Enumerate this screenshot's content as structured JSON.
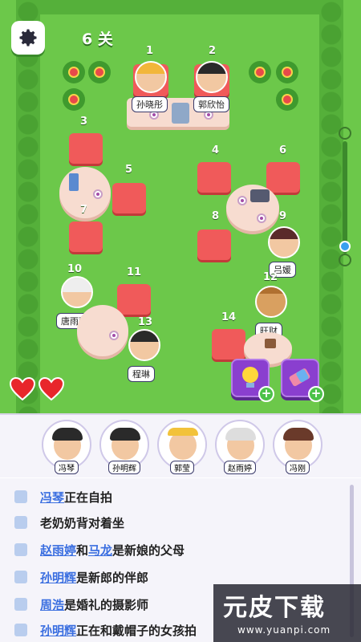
{
  "header": {
    "level": "6 关"
  },
  "colors": {
    "grass": "#6cc84a",
    "chair": "#f05a5a",
    "tool": "#8a3fcf",
    "heart": "#e8262b",
    "highlight": "#3a6ee0"
  },
  "seats": {
    "n1": "1",
    "n2": "2",
    "n3": "3",
    "n4": "4",
    "n5": "5",
    "n6": "6",
    "n7": "7",
    "n8": "8",
    "n9": "9",
    "n10": "10",
    "n11": "11",
    "n12": "12",
    "n13": "13",
    "n14": "14"
  },
  "seated": {
    "s1": "孙晓彤",
    "s2": "郭欣怡",
    "s9": "吕媛",
    "s10": "唐雨萱",
    "s12": "旺财",
    "s13": "程琳"
  },
  "hearts": {
    "count": 2
  },
  "tools": [
    {
      "icon": "lightbulb-icon"
    },
    {
      "icon": "eraser-icon"
    }
  ],
  "guests": [
    "冯琴",
    "孙明辉",
    "郭莹",
    "赵雨婷",
    "冯刚"
  ],
  "clues": [
    {
      "hl": "冯琴",
      "text": "正在自拍"
    },
    {
      "hl": "",
      "text": "老奶奶背对着坐"
    },
    {
      "hl": "赵雨婷",
      "mid": "和",
      "hl2": "马龙",
      "text": "是新娘的父母"
    },
    {
      "hl": "孙明辉",
      "text": "是新郎的伴郎"
    },
    {
      "hl": "周浩",
      "text": "是婚礼的摄影师"
    },
    {
      "hl": "孙明辉",
      "text": "正在和戴帽子的女孩拍"
    }
  ],
  "watermark": {
    "big": "元皮下载",
    "small": "www.yuanpi.com"
  }
}
